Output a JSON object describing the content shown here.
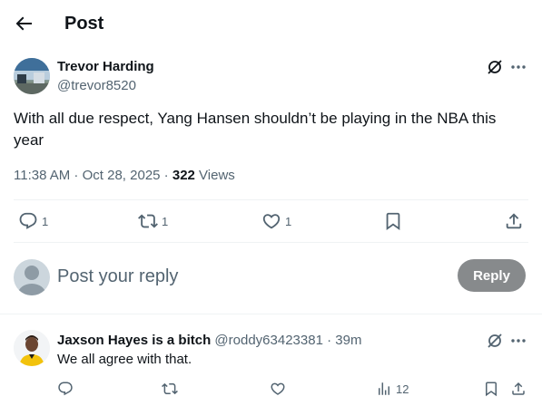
{
  "header": {
    "title": "Post"
  },
  "post": {
    "author_name": "Trevor Harding",
    "author_handle": "@trevor8520",
    "text": "With all due respect, Yang Hansen shouldn’t be playing in the NBA this year",
    "time": "11:38 AM",
    "date": "Oct 28, 2025",
    "meta_sep1": " · ",
    "meta_sep2": " · ",
    "views_count": "322",
    "views_label": " Views",
    "replies": "1",
    "reposts": "1",
    "likes": "1"
  },
  "composer": {
    "placeholder": "Post your reply",
    "button_label": "Reply"
  },
  "reply": {
    "author_name": "Jaxson Hayes is a bitch",
    "author_handle": "@roddy63423381",
    "sep": " · ",
    "age": "39m",
    "text": "We all agree with that.",
    "views": "12"
  },
  "icons": {
    "back": "arrow-left-icon",
    "grok": "grok-icon",
    "more": "more-horizontal-icon",
    "reply": "comment-icon",
    "repost": "repost-icon",
    "like": "heart-icon",
    "bookmark": "bookmark-icon",
    "share": "share-icon",
    "views": "views-chart-icon"
  },
  "colors": {
    "text": "#0f1419",
    "muted": "#536471",
    "divider": "#eff3f4",
    "reply_button": "#878a8c"
  }
}
